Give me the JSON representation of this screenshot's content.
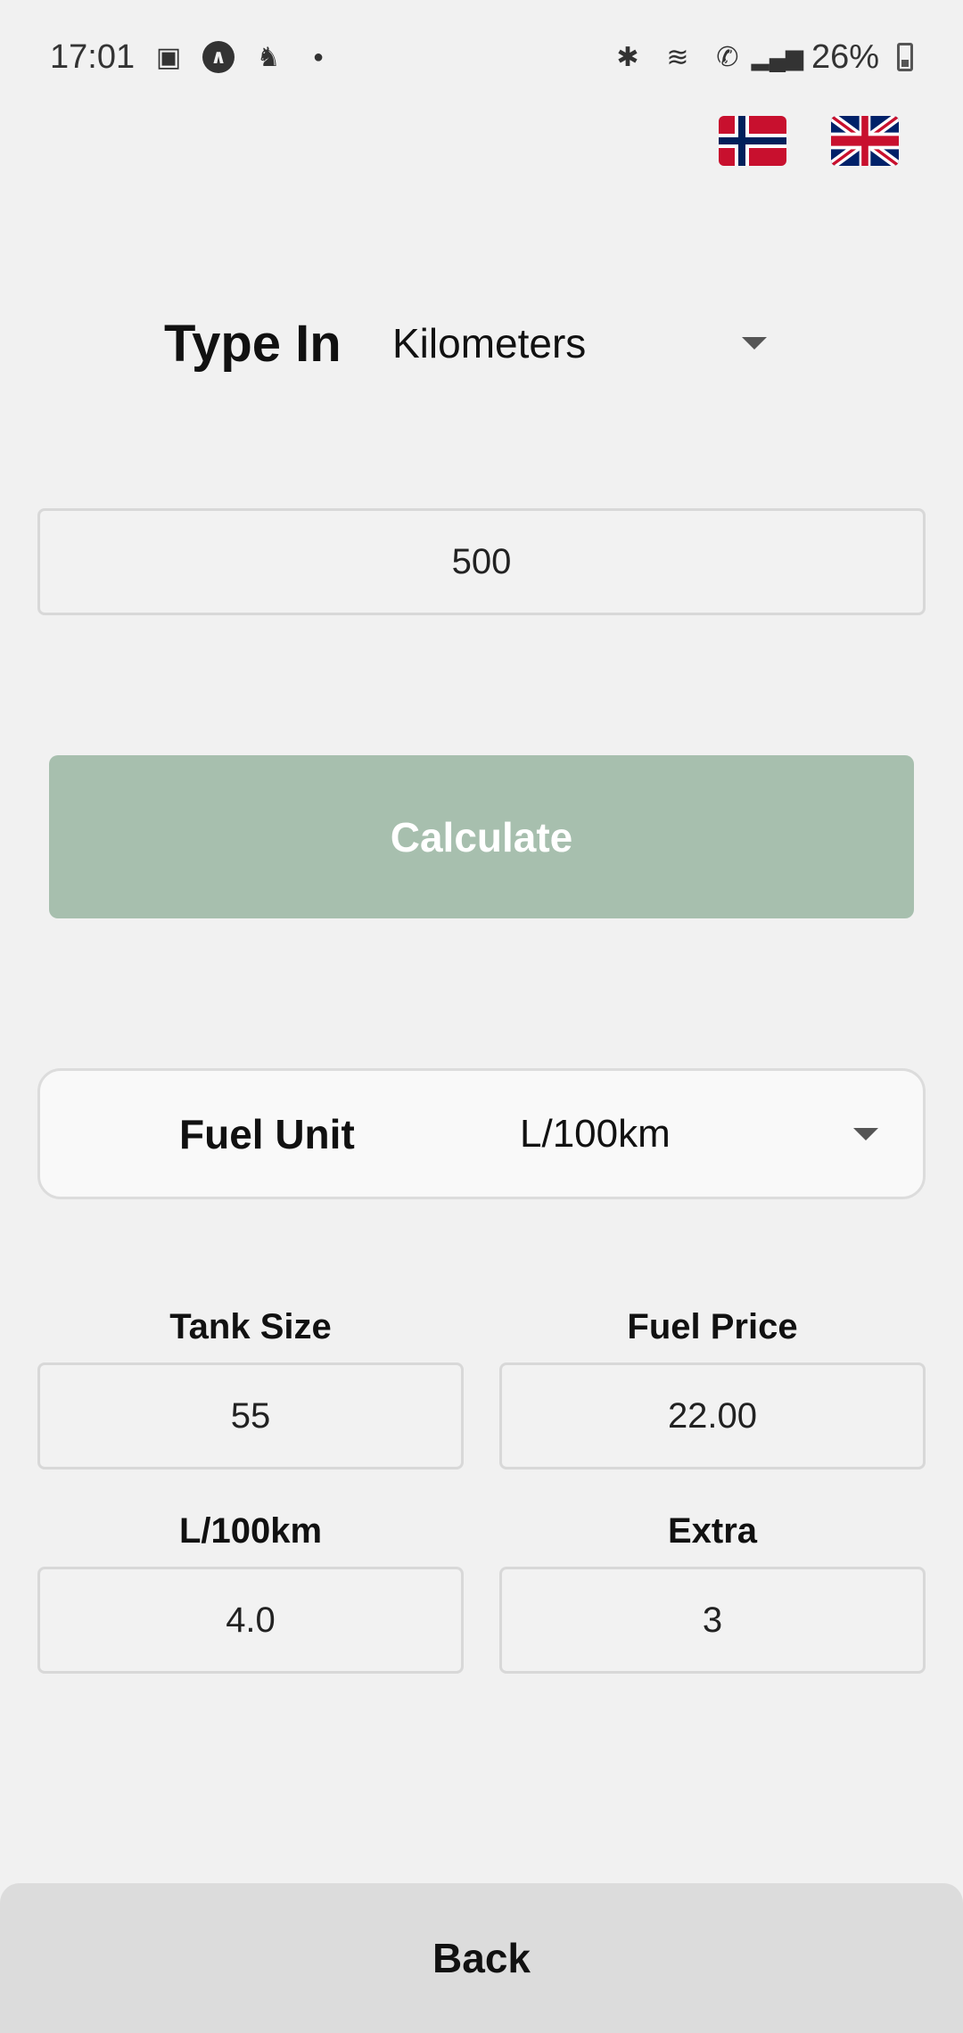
{
  "status_bar": {
    "time": "17:01",
    "battery": "26%",
    "left_icons": [
      "gallery-icon",
      "app-icon",
      "notification-icon",
      "dot-icon"
    ],
    "right_icons": [
      "bluetooth-icon",
      "wifi-icon",
      "wifi-calling-icon",
      "signal-icon",
      "battery-icon"
    ]
  },
  "languages": [
    {
      "name": "norwegian-flag-icon"
    },
    {
      "name": "uk-flag-icon"
    }
  ],
  "type_in": {
    "label": "Type In",
    "selected": "Kilometers"
  },
  "distance_input": {
    "value": "500"
  },
  "calculate_button": {
    "label": "Calculate",
    "color": "#a7bfae"
  },
  "fuel_unit": {
    "label": "Fuel Unit",
    "selected": "L/100km"
  },
  "fields": {
    "tank_size": {
      "label": "Tank Size",
      "value": "55"
    },
    "fuel_price": {
      "label": "Fuel Price",
      "value": "22.00"
    },
    "consumption": {
      "label": "L/100km",
      "value": "4.0"
    },
    "extra": {
      "label": "Extra",
      "value": "3"
    }
  },
  "back_button": {
    "label": "Back"
  }
}
